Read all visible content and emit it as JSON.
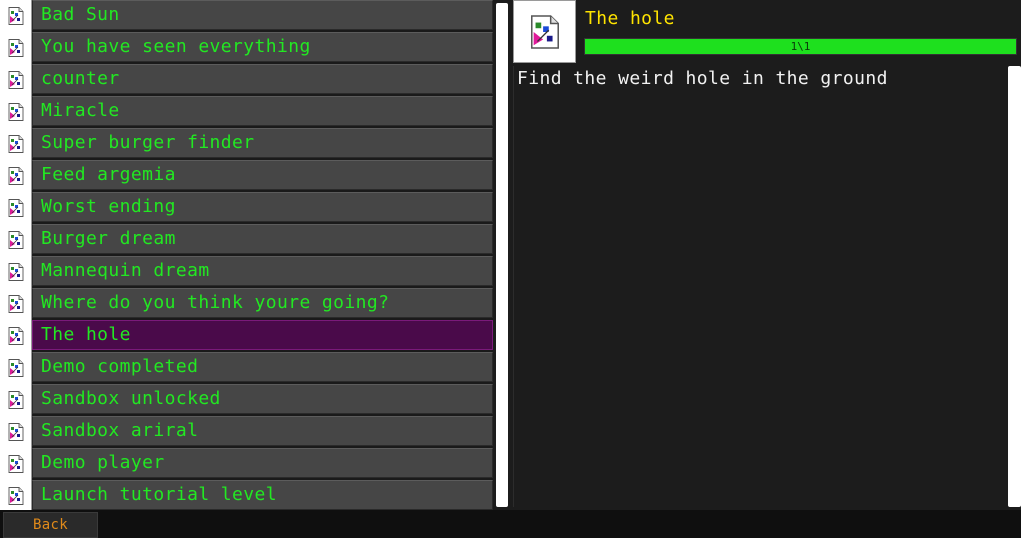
{
  "achievements": [
    {
      "label": "Bad Sun",
      "icon": "broken-image-icon"
    },
    {
      "label": "You have seen everything",
      "icon": "broken-image-icon"
    },
    {
      "label": "counter",
      "icon": "broken-image-icon"
    },
    {
      "label": "Miracle",
      "icon": "broken-image-icon"
    },
    {
      "label": "Super burger finder",
      "icon": "broken-image-icon"
    },
    {
      "label": "Feed argemia",
      "icon": "broken-image-icon"
    },
    {
      "label": "Worst ending",
      "icon": "broken-image-icon"
    },
    {
      "label": "Burger dream",
      "icon": "broken-image-icon"
    },
    {
      "label": "Mannequin dream",
      "icon": "broken-image-icon"
    },
    {
      "label": "Where do you think youre going?",
      "icon": "broken-image-icon"
    },
    {
      "label": "The hole",
      "icon": "broken-image-icon",
      "selected": true
    },
    {
      "label": "Demo completed",
      "icon": "broken-image-icon"
    },
    {
      "label": "Sandbox unlocked",
      "icon": "broken-image-icon"
    },
    {
      "label": "Sandbox ariral",
      "icon": "broken-image-icon"
    },
    {
      "label": "Demo player",
      "icon": "broken-image-icon"
    },
    {
      "label": "Launch tutorial level",
      "icon": "broken-image-icon"
    }
  ],
  "detail": {
    "title": "The hole",
    "progress_text": "1\\1",
    "progress_fraction": 1.0,
    "description": "Find the weird hole in the ground",
    "icon": "broken-image-icon"
  },
  "footer": {
    "back_label": "Back"
  },
  "colors": {
    "entry_text": "#22e822",
    "title_text": "#ffe400",
    "selected_bg": "#4a0a4a",
    "progress_fill": "#1ee01e",
    "back_text": "#e08a1a"
  }
}
